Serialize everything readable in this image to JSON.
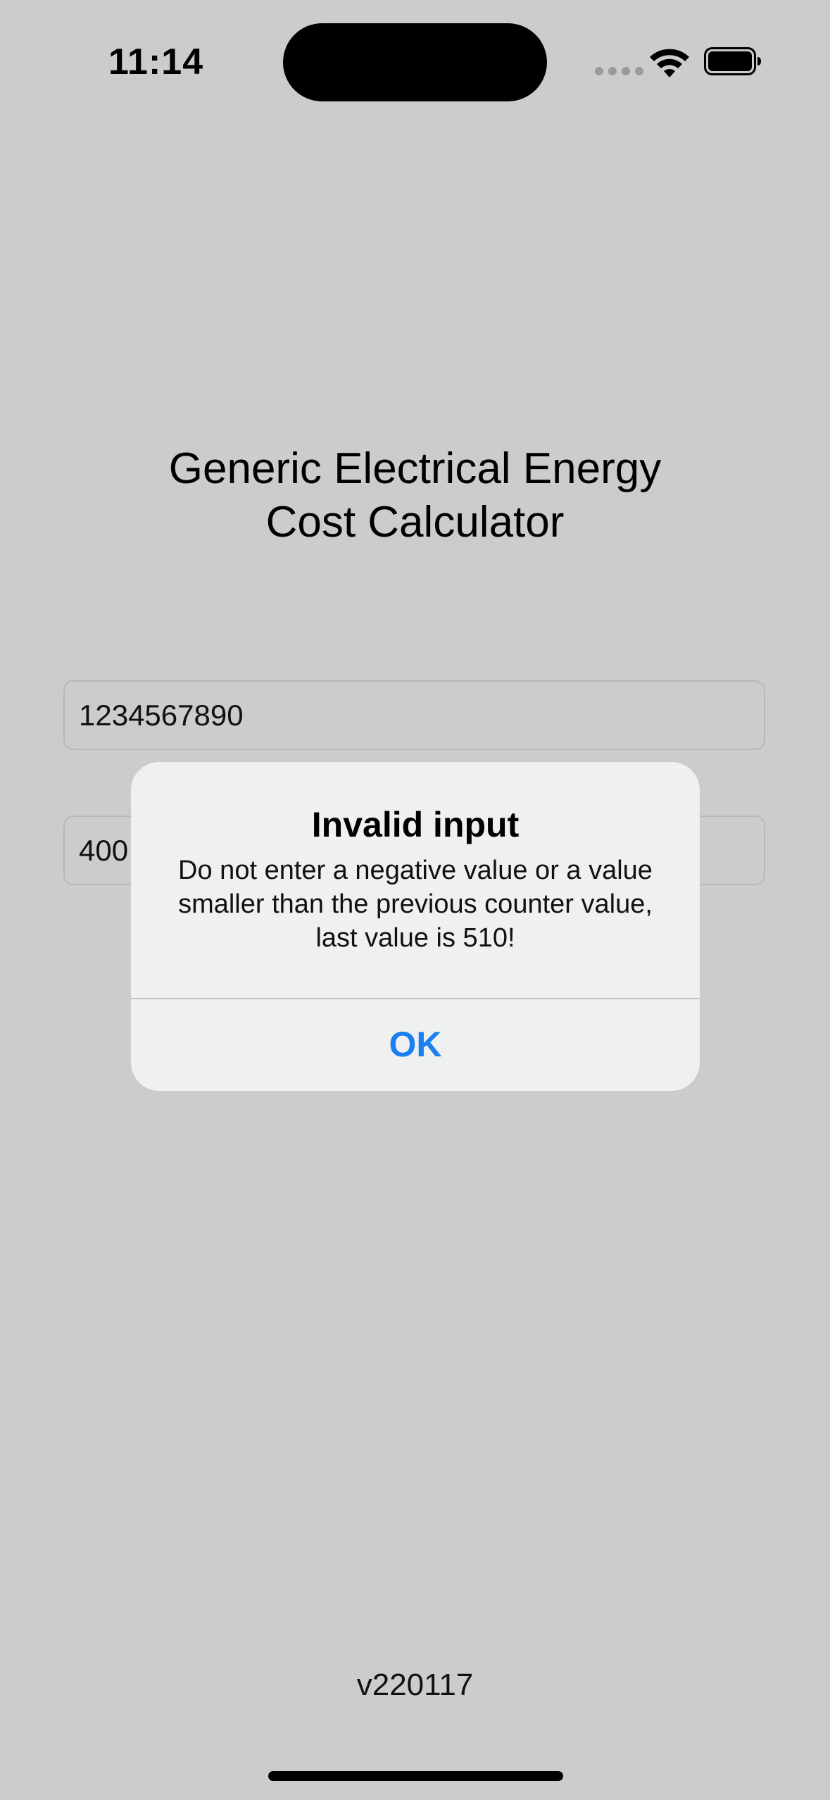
{
  "status_bar": {
    "time": "11:14",
    "icons": [
      "cellular-signal-icon",
      "wifi-icon",
      "battery-icon"
    ]
  },
  "app": {
    "title": "Generic Electrical Energy\nCost Calculator",
    "fields": [
      {
        "value": "1234567890"
      },
      {
        "value": "400"
      }
    ],
    "version": "v220117"
  },
  "alert": {
    "title": "Invalid input",
    "message": "Do not enter a negative value or a value smaller than the previous counter value, last value is 510!",
    "ok_label": "OK"
  },
  "colors": {
    "background": "#cccccc",
    "alert_background": "#eff0f0",
    "accent": "#1a7ff1"
  }
}
